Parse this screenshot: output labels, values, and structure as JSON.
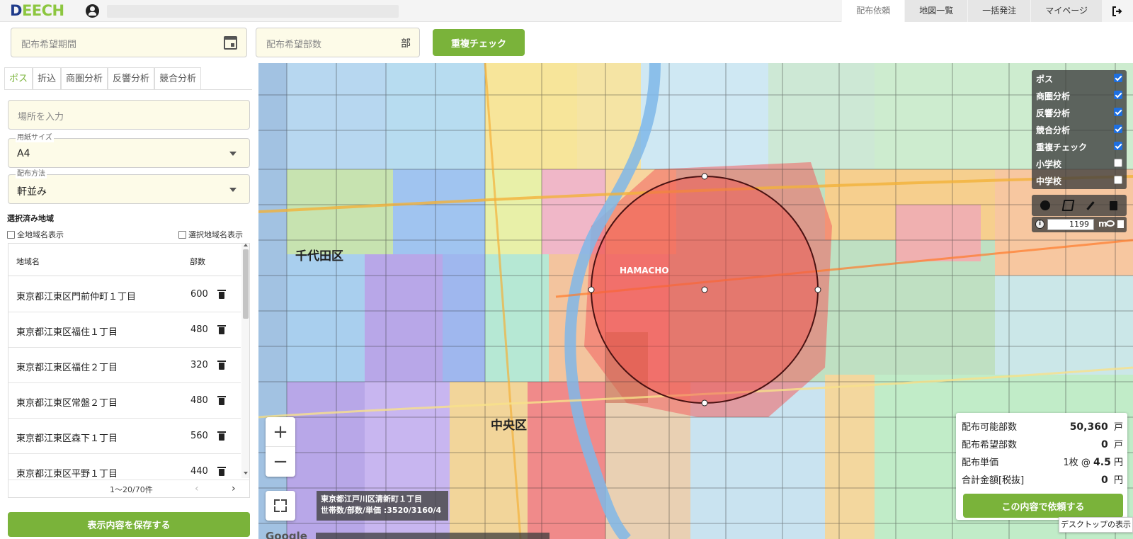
{
  "app": {
    "logo_text": "DEECH",
    "logo_text_main": "D",
    "logo_text_accent": "EECH"
  },
  "nav": {
    "tabs": [
      {
        "label": "配布依頼",
        "active": true
      },
      {
        "label": "地図一覧",
        "active": false
      },
      {
        "label": "一括発注",
        "active": false
      },
      {
        "label": "マイページ",
        "active": false
      }
    ],
    "logout_icon": "logout-icon"
  },
  "request": {
    "period_placeholder": "配布希望期間",
    "copies_placeholder": "配布希望部数",
    "copies_unit": "部",
    "duplicate_check_label": "重複チェック"
  },
  "panel": {
    "tabs": [
      {
        "label": "ポス",
        "active": true
      },
      {
        "label": "折込",
        "active": false
      },
      {
        "label": "商圏分析",
        "active": false
      },
      {
        "label": "反響分析",
        "active": false
      },
      {
        "label": "競合分析",
        "active": false
      }
    ],
    "place_placeholder": "場所を入力",
    "paper_size": {
      "label": "用紙サイズ",
      "value": "A4"
    },
    "method": {
      "label": "配布方法",
      "value": "軒並み"
    },
    "selected_title": "選択済み地域",
    "show_all_names": "全地域名表示",
    "show_selected_names": "選択地域名表示",
    "table": {
      "col_name": "地域名",
      "col_count": "部数",
      "rows": [
        {
          "name": "東京都江東区門前仲町１丁目",
          "count": "600"
        },
        {
          "name": "東京都江東区福住１丁目",
          "count": "480"
        },
        {
          "name": "東京都江東区福住２丁目",
          "count": "320"
        },
        {
          "name": "東京都江東区常盤２丁目",
          "count": "480"
        },
        {
          "name": "東京都江東区森下１丁目",
          "count": "560"
        },
        {
          "name": "東京都江東区平野１丁目",
          "count": "440"
        }
      ]
    },
    "pager": {
      "info": "1～20/70件",
      "prev": "‹",
      "next": "›"
    },
    "save_label": "表示内容を保存する"
  },
  "map": {
    "labels": {
      "chiyoda": "千代田区",
      "chuo": "中央区",
      "hamacho": "HAMACHO"
    },
    "layers": [
      {
        "label": "ポス",
        "checked": true
      },
      {
        "label": "商圏分析",
        "checked": true
      },
      {
        "label": "反響分析",
        "checked": true
      },
      {
        "label": "競合分析",
        "checked": true
      },
      {
        "label": "重複チェック",
        "checked": true
      },
      {
        "label": "小学校",
        "checked": false
      },
      {
        "label": "中学校",
        "checked": false
      }
    ],
    "radius_value": "1199",
    "radius_unit": "m",
    "hover": {
      "line1": "東京都江戸川区清新町１丁目",
      "line2": "世帯数/部数/単価 :3520/3160/4"
    },
    "zoom_in": "+",
    "zoom_out": "−",
    "google": "Google"
  },
  "summary": {
    "available_label": "配布可能部数",
    "available_value": "50,360",
    "available_unit": "戸",
    "requested_label": "配布希望部数",
    "requested_value": "0",
    "requested_unit": "戸",
    "unit_price_label": "配布単価",
    "unit_price_prefix": "1枚 @",
    "unit_price_value": "4.5",
    "unit_price_unit": "円",
    "total_label": "合計金額[税抜]",
    "total_value": "0",
    "total_unit": "円",
    "order_label": "この内容で依頼する"
  },
  "tooltip": {
    "desktop": "デスクトップの表示"
  },
  "colors": {
    "accent_green": "#7ab33a",
    "logo_blue": "#1e3a8a",
    "checkbox_blue": "#1e6fe0",
    "circle_fill": "#f0504a"
  }
}
